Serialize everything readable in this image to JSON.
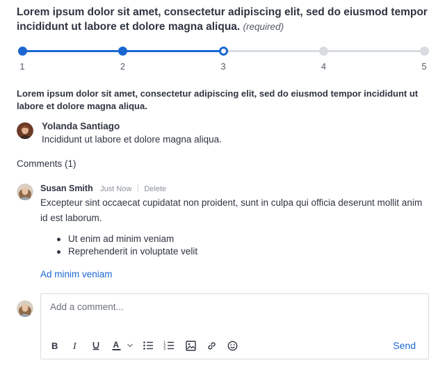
{
  "question": {
    "text": "Lorem ipsum dolor sit amet, consectetur adipiscing elit, sed do eiusmod tempor incididunt ut labore et dolore magna aliqua.",
    "required_label": "(required)"
  },
  "scale": {
    "min_label": "1",
    "max_label": "5",
    "labels": [
      "1",
      "2",
      "3",
      "4",
      "5"
    ],
    "selected": 3,
    "accent_color": "#1a67d2",
    "inactive_color": "#d8dbe1"
  },
  "description": "Lorem ipsum dolor sit amet, consectetur adipiscing elit, sed do eiusmod tempor incididunt ut labore et dolore magna aliqua.",
  "assignee": {
    "name": "Yolanda Santiago",
    "text": "Incididunt ut labore et dolore magna aliqua."
  },
  "comments": {
    "header": "Comments (1)",
    "items": [
      {
        "author": "Susan Smith",
        "time": "Just Now",
        "delete_label": "Delete",
        "body": "Excepteur sint occaecat cupidatat non proident, sunt in culpa qui officia deserunt mollit anim id est laborum.",
        "bullets": [
          "Ut enim ad minim veniam",
          "Reprehenderit in voluptate velit"
        ],
        "link": "Ad minim veniam"
      }
    ]
  },
  "editor": {
    "placeholder": "Add a comment...",
    "send_label": "Send",
    "toolbar_icons": [
      "bold-icon",
      "italic-icon",
      "underline-icon",
      "text-color-icon",
      "chevron-down-icon",
      "bullet-list-icon",
      "numbered-list-icon",
      "image-icon",
      "link-icon",
      "emoji-icon"
    ]
  }
}
